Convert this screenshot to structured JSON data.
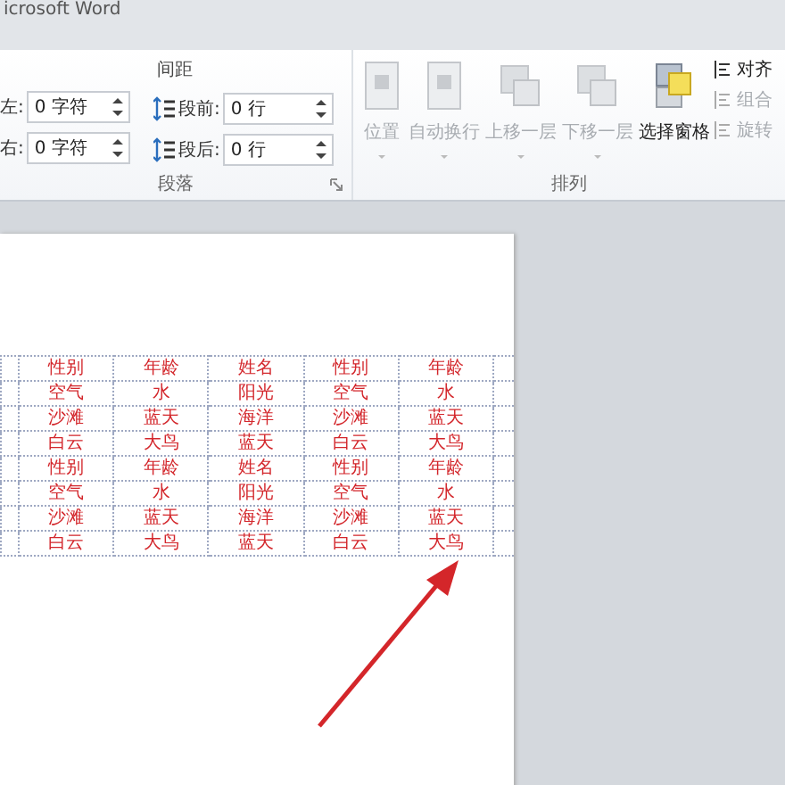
{
  "window": {
    "title": "icrosoft Word"
  },
  "paragraph_group": {
    "label": "段落",
    "indent_fields": [
      {
        "label": "左:",
        "value": "0 字符"
      },
      {
        "label": "右:",
        "value": "0 字符"
      }
    ],
    "spacing_label": "间距",
    "spacing_fields": [
      {
        "label": "段前:",
        "value": "0 行"
      },
      {
        "label": "段后:",
        "value": "0 行"
      }
    ]
  },
  "arrange_group": {
    "label": "排列",
    "large_buttons": [
      {
        "label": "位置",
        "disabled": true
      },
      {
        "label": "自动换行",
        "disabled": true
      },
      {
        "label": "上移一层",
        "disabled": true
      },
      {
        "label": "下移一层",
        "disabled": true
      },
      {
        "label": "选择窗格",
        "disabled": false
      }
    ],
    "small_buttons": [
      {
        "label": "对齐",
        "disabled": false
      },
      {
        "label": "组合",
        "disabled": true
      },
      {
        "label": "旋转",
        "disabled": true
      }
    ]
  },
  "table": {
    "rows": [
      [
        "性别",
        "年龄",
        "姓名",
        "性别",
        "年龄"
      ],
      [
        "空气",
        "水",
        "阳光",
        "空气",
        "水"
      ],
      [
        "沙滩",
        "蓝天",
        "海洋",
        "沙滩",
        "蓝天"
      ],
      [
        "白云",
        "大鸟",
        "蓝天",
        "白云",
        "大鸟"
      ],
      [
        "性别",
        "年龄",
        "姓名",
        "性别",
        "年龄"
      ],
      [
        "空气",
        "水",
        "阳光",
        "空气",
        "水"
      ],
      [
        "沙滩",
        "蓝天",
        "海洋",
        "沙滩",
        "蓝天"
      ],
      [
        "白云",
        "大鸟",
        "蓝天",
        "白云",
        "大鸟"
      ]
    ]
  }
}
